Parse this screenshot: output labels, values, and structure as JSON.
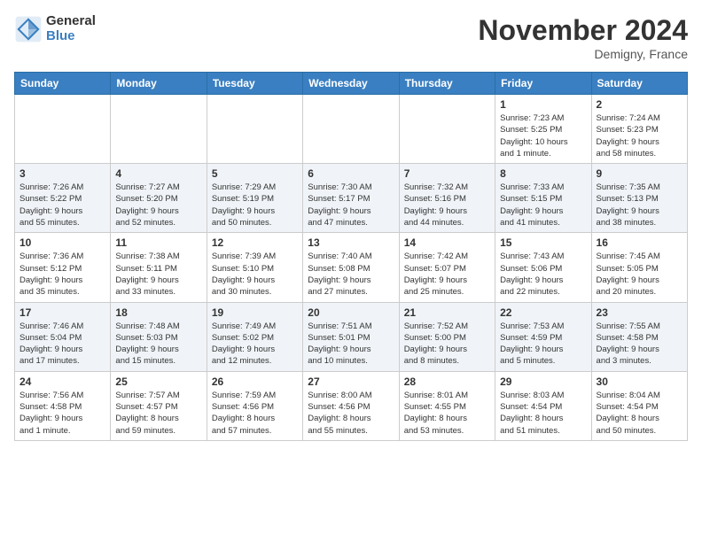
{
  "logo": {
    "general": "General",
    "blue": "Blue"
  },
  "title": "November 2024",
  "location": "Demigny, France",
  "weekdays": [
    "Sunday",
    "Monday",
    "Tuesday",
    "Wednesday",
    "Thursday",
    "Friday",
    "Saturday"
  ],
  "weeks": [
    [
      {
        "day": "",
        "info": ""
      },
      {
        "day": "",
        "info": ""
      },
      {
        "day": "",
        "info": ""
      },
      {
        "day": "",
        "info": ""
      },
      {
        "day": "",
        "info": ""
      },
      {
        "day": "1",
        "info": "Sunrise: 7:23 AM\nSunset: 5:25 PM\nDaylight: 10 hours\nand 1 minute."
      },
      {
        "day": "2",
        "info": "Sunrise: 7:24 AM\nSunset: 5:23 PM\nDaylight: 9 hours\nand 58 minutes."
      }
    ],
    [
      {
        "day": "3",
        "info": "Sunrise: 7:26 AM\nSunset: 5:22 PM\nDaylight: 9 hours\nand 55 minutes."
      },
      {
        "day": "4",
        "info": "Sunrise: 7:27 AM\nSunset: 5:20 PM\nDaylight: 9 hours\nand 52 minutes."
      },
      {
        "day": "5",
        "info": "Sunrise: 7:29 AM\nSunset: 5:19 PM\nDaylight: 9 hours\nand 50 minutes."
      },
      {
        "day": "6",
        "info": "Sunrise: 7:30 AM\nSunset: 5:17 PM\nDaylight: 9 hours\nand 47 minutes."
      },
      {
        "day": "7",
        "info": "Sunrise: 7:32 AM\nSunset: 5:16 PM\nDaylight: 9 hours\nand 44 minutes."
      },
      {
        "day": "8",
        "info": "Sunrise: 7:33 AM\nSunset: 5:15 PM\nDaylight: 9 hours\nand 41 minutes."
      },
      {
        "day": "9",
        "info": "Sunrise: 7:35 AM\nSunset: 5:13 PM\nDaylight: 9 hours\nand 38 minutes."
      }
    ],
    [
      {
        "day": "10",
        "info": "Sunrise: 7:36 AM\nSunset: 5:12 PM\nDaylight: 9 hours\nand 35 minutes."
      },
      {
        "day": "11",
        "info": "Sunrise: 7:38 AM\nSunset: 5:11 PM\nDaylight: 9 hours\nand 33 minutes."
      },
      {
        "day": "12",
        "info": "Sunrise: 7:39 AM\nSunset: 5:10 PM\nDaylight: 9 hours\nand 30 minutes."
      },
      {
        "day": "13",
        "info": "Sunrise: 7:40 AM\nSunset: 5:08 PM\nDaylight: 9 hours\nand 27 minutes."
      },
      {
        "day": "14",
        "info": "Sunrise: 7:42 AM\nSunset: 5:07 PM\nDaylight: 9 hours\nand 25 minutes."
      },
      {
        "day": "15",
        "info": "Sunrise: 7:43 AM\nSunset: 5:06 PM\nDaylight: 9 hours\nand 22 minutes."
      },
      {
        "day": "16",
        "info": "Sunrise: 7:45 AM\nSunset: 5:05 PM\nDaylight: 9 hours\nand 20 minutes."
      }
    ],
    [
      {
        "day": "17",
        "info": "Sunrise: 7:46 AM\nSunset: 5:04 PM\nDaylight: 9 hours\nand 17 minutes."
      },
      {
        "day": "18",
        "info": "Sunrise: 7:48 AM\nSunset: 5:03 PM\nDaylight: 9 hours\nand 15 minutes."
      },
      {
        "day": "19",
        "info": "Sunrise: 7:49 AM\nSunset: 5:02 PM\nDaylight: 9 hours\nand 12 minutes."
      },
      {
        "day": "20",
        "info": "Sunrise: 7:51 AM\nSunset: 5:01 PM\nDaylight: 9 hours\nand 10 minutes."
      },
      {
        "day": "21",
        "info": "Sunrise: 7:52 AM\nSunset: 5:00 PM\nDaylight: 9 hours\nand 8 minutes."
      },
      {
        "day": "22",
        "info": "Sunrise: 7:53 AM\nSunset: 4:59 PM\nDaylight: 9 hours\nand 5 minutes."
      },
      {
        "day": "23",
        "info": "Sunrise: 7:55 AM\nSunset: 4:58 PM\nDaylight: 9 hours\nand 3 minutes."
      }
    ],
    [
      {
        "day": "24",
        "info": "Sunrise: 7:56 AM\nSunset: 4:58 PM\nDaylight: 9 hours\nand 1 minute."
      },
      {
        "day": "25",
        "info": "Sunrise: 7:57 AM\nSunset: 4:57 PM\nDaylight: 8 hours\nand 59 minutes."
      },
      {
        "day": "26",
        "info": "Sunrise: 7:59 AM\nSunset: 4:56 PM\nDaylight: 8 hours\nand 57 minutes."
      },
      {
        "day": "27",
        "info": "Sunrise: 8:00 AM\nSunset: 4:56 PM\nDaylight: 8 hours\nand 55 minutes."
      },
      {
        "day": "28",
        "info": "Sunrise: 8:01 AM\nSunset: 4:55 PM\nDaylight: 8 hours\nand 53 minutes."
      },
      {
        "day": "29",
        "info": "Sunrise: 8:03 AM\nSunset: 4:54 PM\nDaylight: 8 hours\nand 51 minutes."
      },
      {
        "day": "30",
        "info": "Sunrise: 8:04 AM\nSunset: 4:54 PM\nDaylight: 8 hours\nand 50 minutes."
      }
    ]
  ]
}
